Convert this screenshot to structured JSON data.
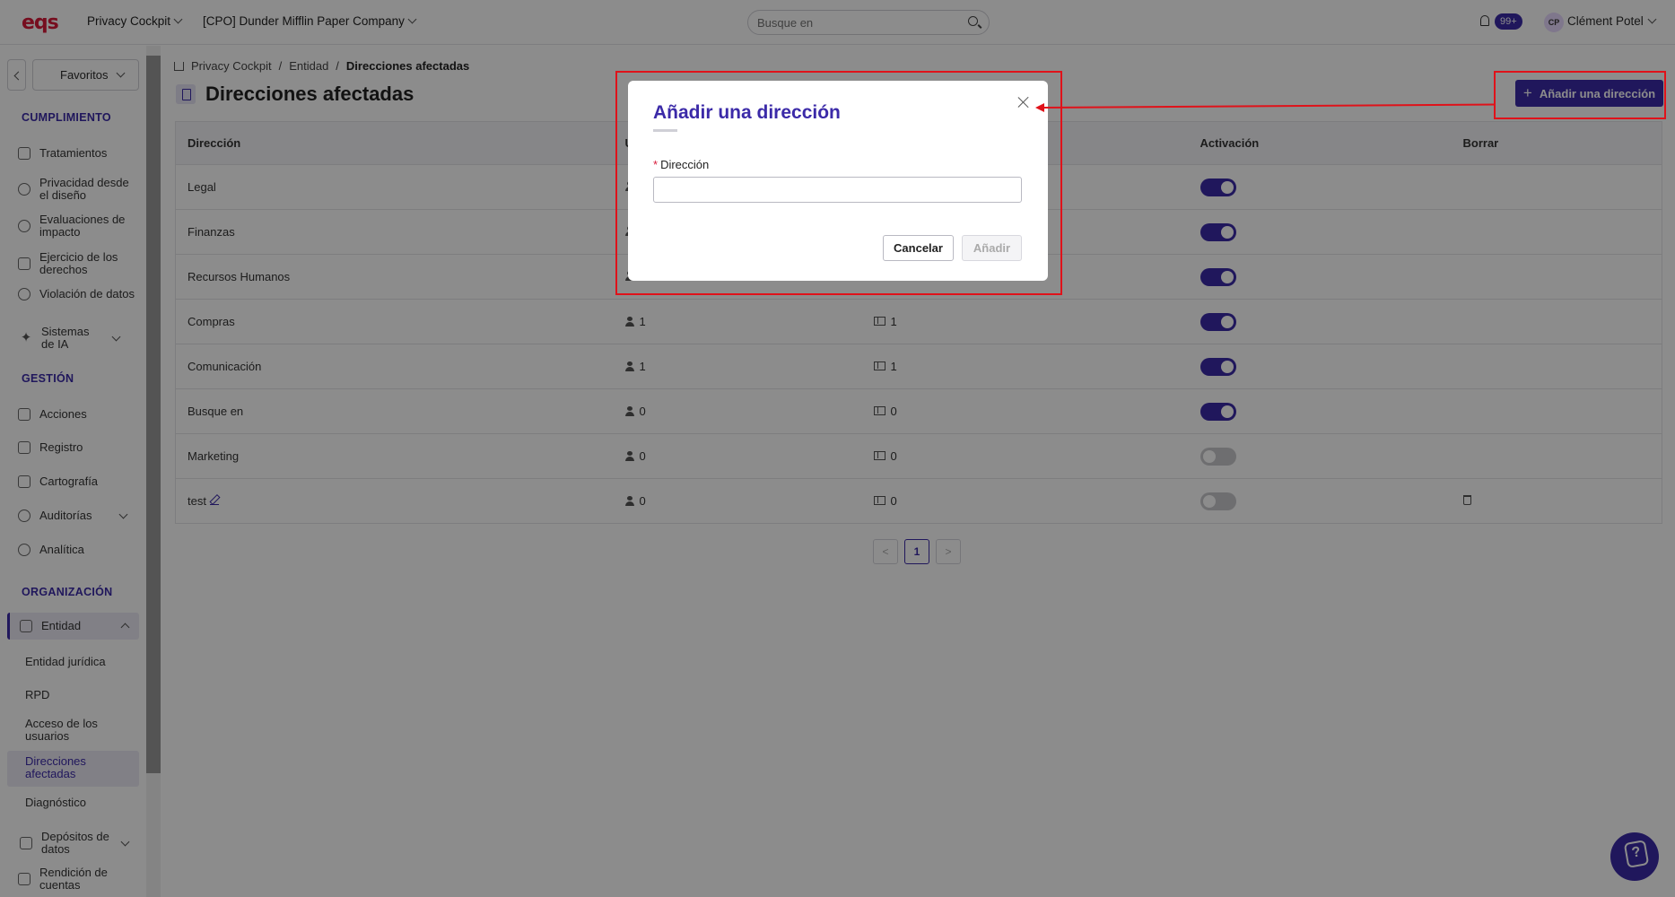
{
  "topbar": {
    "logo": "eqs",
    "product": "Privacy Cockpit",
    "company": "[CPO] Dunder Mifflin Paper Company",
    "search_placeholder": "Busque en",
    "notifications": "99+",
    "avatar_initials": "CP",
    "user_name": "Clément Potel"
  },
  "sidebar": {
    "favorites": "Favoritos",
    "sections": {
      "compliance": "CUMPLIMIENTO",
      "management": "GESTIÓN",
      "organization": "ORGANIZACIÓN"
    },
    "compliance_items": [
      "Tratamientos",
      "Privacidad desde el diseño",
      "Evaluaciones de impacto",
      "Ejercicio de los derechos",
      "Violación de datos",
      "Sistemas de IA"
    ],
    "management_items": [
      "Acciones",
      "Registro",
      "Cartografía",
      "Auditorías",
      "Analítica"
    ],
    "organization_items": [
      "Entidad"
    ],
    "entity_subitems": [
      "Entidad jurídica",
      "RPD",
      "Acceso de los usuarios",
      "Direcciones afectadas",
      "Diagnóstico"
    ],
    "more_items": [
      "Depósitos de datos",
      "Rendición de cuentas"
    ]
  },
  "breadcrumb": [
    "Privacy Cockpit",
    "Entidad",
    "Direcciones afectadas"
  ],
  "page": {
    "title": "Direcciones afectadas",
    "add_button": "Añadir una dirección"
  },
  "table": {
    "headers": [
      "Dirección",
      "U",
      "",
      "Activación",
      "Borrar"
    ],
    "rows": [
      {
        "name": "Legal",
        "users": "",
        "entries": "",
        "active": true
      },
      {
        "name": "Finanzas",
        "users": "",
        "entries": "",
        "active": true
      },
      {
        "name": "Recursos Humanos",
        "users": "",
        "entries": "",
        "active": true
      },
      {
        "name": "Compras",
        "users": "1",
        "entries": "1",
        "active": true
      },
      {
        "name": "Comunicación",
        "users": "1",
        "entries": "1",
        "active": true
      },
      {
        "name": "Busque en",
        "users": "0",
        "entries": "0",
        "active": true
      },
      {
        "name": "Marketing",
        "users": "0",
        "entries": "0",
        "active": false
      },
      {
        "name": "test",
        "users": "0",
        "entries": "0",
        "active": false
      }
    ]
  },
  "pagination": {
    "prev": "<",
    "current": "1",
    "next": ">"
  },
  "modal": {
    "title": "Añadir una dirección",
    "field_label": "Dirección",
    "required_mark": "*",
    "field_value": "",
    "cancel": "Cancelar",
    "submit": "Añadir"
  },
  "colors": {
    "accent": "#3b2aa8",
    "brand_red": "#d81b3a",
    "annotation": "#e0121a"
  }
}
